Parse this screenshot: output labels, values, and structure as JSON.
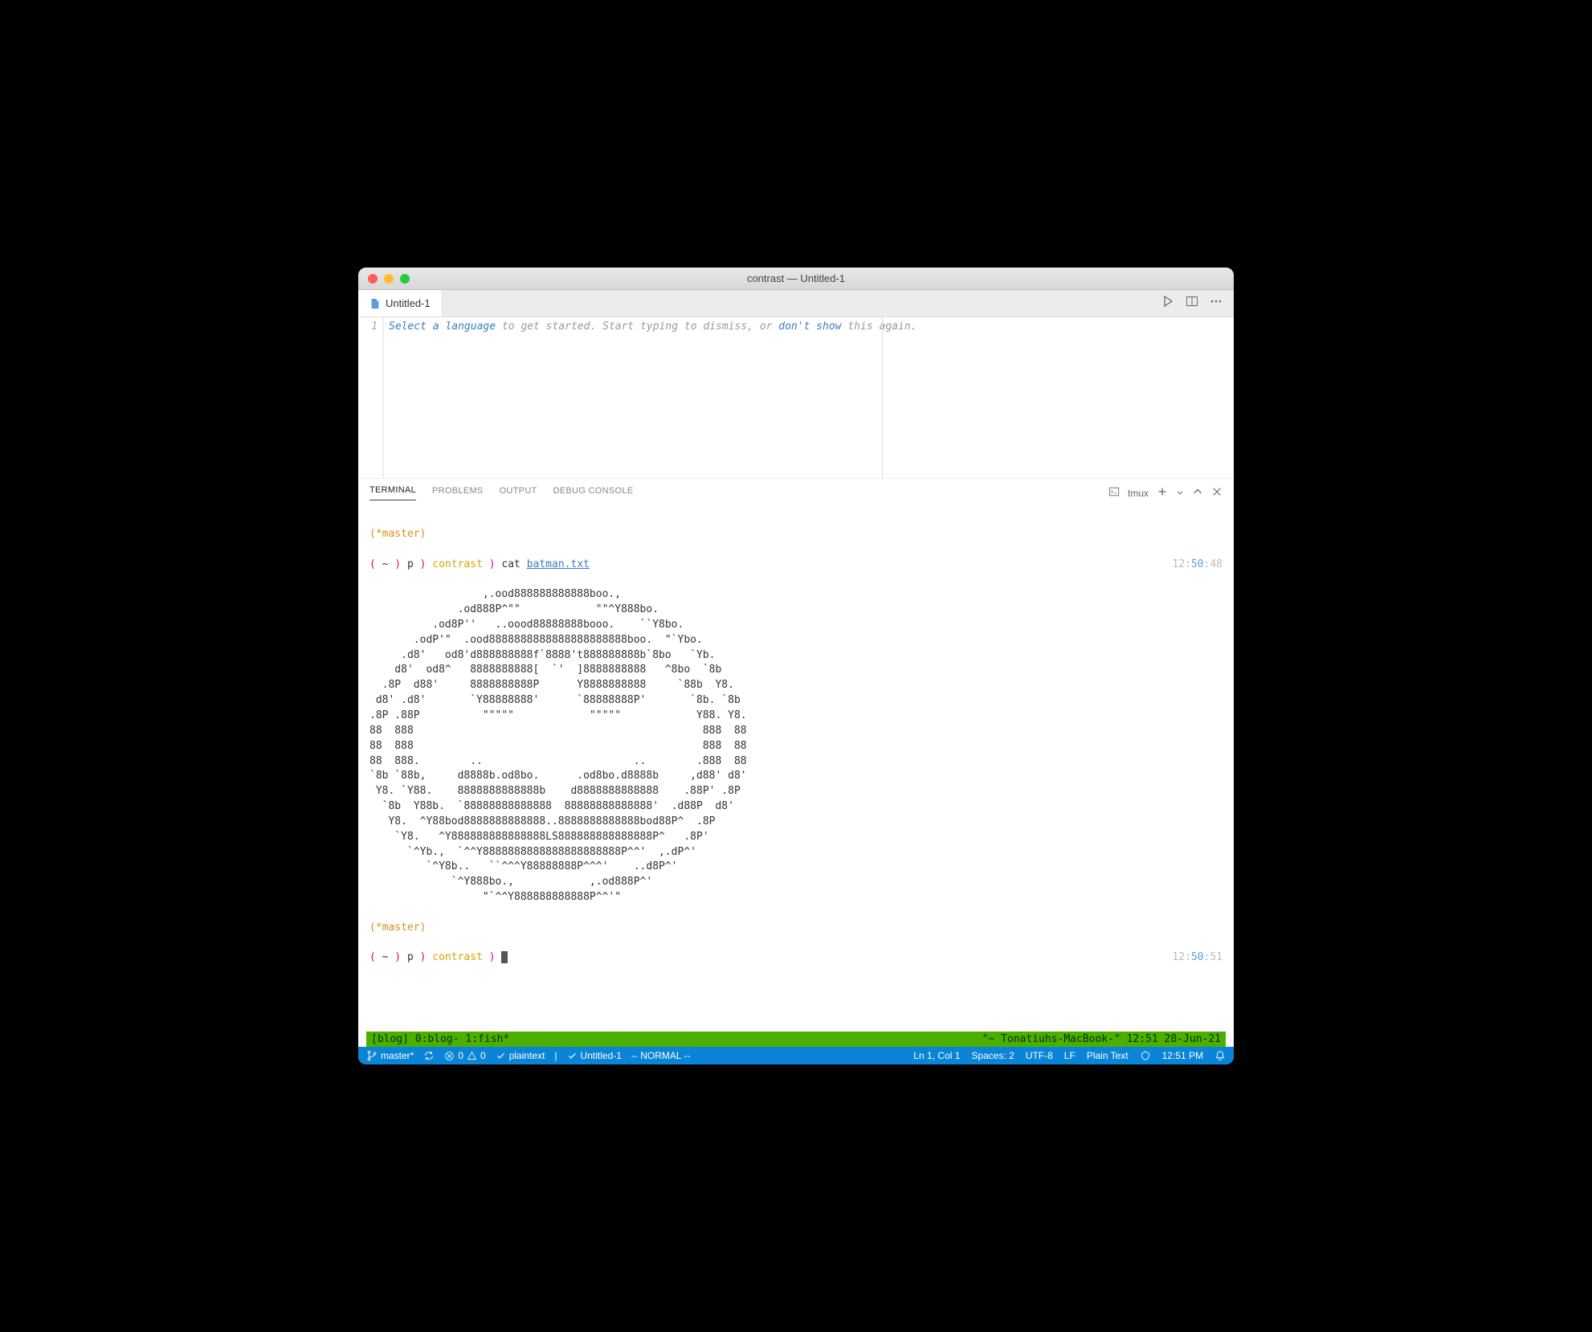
{
  "window": {
    "title": "contrast — Untitled-1"
  },
  "tab": {
    "label": "Untitled-1"
  },
  "editor": {
    "line_number": "1",
    "hint_link1": "Select a language",
    "hint_mid": " to get started. Start typing to dismiss, or ",
    "hint_link2": "don't show",
    "hint_end": " this again."
  },
  "panel": {
    "tabs": {
      "terminal": "TERMINAL",
      "problems": "PROBLEMS",
      "output": "OUTPUT",
      "debug": "DEBUG CONSOLE"
    },
    "shell_label": "tmux"
  },
  "terminal": {
    "branch": "(*master)",
    "prompt_open": "( ",
    "tilde": "~",
    "prompt_mid1": " ) ",
    "p": "p",
    "prompt_mid2": " ) ",
    "dir": "contrast",
    "prompt_close": " ) ",
    "cmd": "cat ",
    "arg": "batman.txt",
    "time1_h": "12",
    "time1_m": "50",
    "time1_s": "48",
    "time2_h": "12",
    "time2_m": "50",
    "time2_s": "51",
    "ascii": "                  ,.ood888888888888boo.,\n              .od888P^\"\"            \"\"^Y888bo.\n          .od8P''   ..oood88888888booo.    ``Y8bo.\n       .odP'\"  .ood8888888888888888888888boo.  \"`Ybo.\n     .d8'   od8'd888888888f`8888't888888888b`8bo   `Yb.\n    d8'  od8^   8888888888[  `'  ]8888888888   ^8bo  `8b\n  .8P  d88'     8888888888P      Y8888888888     `88b  Y8.\n d8' .d8'       `Y88888888'      `88888888P'       `8b. `8b\n.8P .88P          \"\"\"\"\"            \"\"\"\"\"            Y88. Y8.\n88  888                                              888  88\n88  888                                              888  88\n88  888.        ..                        ..        .888  88\n`8b `88b,     d8888b.od8bo.      .od8bo.d8888b     ,d88' d8'\n Y8. `Y88.    8888888888888b    d8888888888888    .88P' .8P\n  `8b  Y88b.  `88888888888888  88888888888888'  .d88P  d8'\n   Y8.  ^Y88bod8888888888888..8888888888888bod88P^  .8P\n    `Y8.   ^Y888888888888888LS888888888888888P^   .8P'\n      `^Yb.,  `^^Y8888888888888888888888P^^'  ,.dP^'\n         `^Y8b..   ``^^^Y88888888P^^^'    ..d8P^'\n             `^Y888bo.,            ,.od888P^'\n                  \"`^^Y888888888888P^^'\""
  },
  "tmux": {
    "left": "[blog] 0:blog- 1:fish*",
    "right": "\"~  Tonatiuhs-MacBook-\" 12:51 28-Jun-21"
  },
  "status": {
    "branch": "master*",
    "errors": "0",
    "warnings": "0",
    "lang": "plaintext",
    "file": "Untitled-1",
    "mode": "-- NORMAL --",
    "pos": "Ln 1, Col 1",
    "spaces": "Spaces: 2",
    "encoding": "UTF-8",
    "eol": "LF",
    "filetype": "Plain Text",
    "clock": "12:51 PM"
  }
}
